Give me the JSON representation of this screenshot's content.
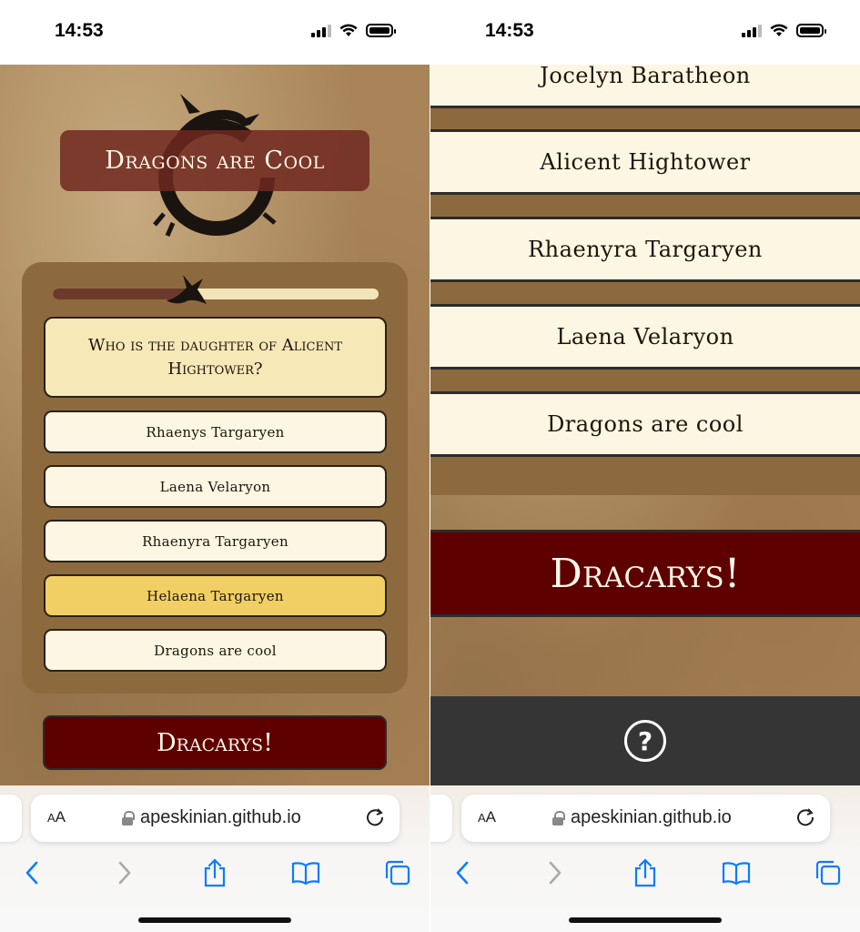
{
  "status_bar": {
    "time": "14:53"
  },
  "browser": {
    "aa_label_big": "A",
    "aa_label_small": "A",
    "url": "apeskinian.github.io"
  },
  "colors": {
    "parchment": "#a88458",
    "panel": "#8d6a3e",
    "title_box": "#702820",
    "answer_bg": "#fdf6e2",
    "selected_answer": "#f1cf64",
    "question_bg": "#f7e8b8",
    "submit_bg": "#5e0000",
    "footer_bg": "#353535",
    "ios_blue": "#0a7cff"
  },
  "left_screen": {
    "title": "Dragons are Cool",
    "progress": 0.45,
    "question": "Who is the daughter of Alicent Hightower?",
    "answers": [
      {
        "label": "Rhaenys Targaryen",
        "selected": false
      },
      {
        "label": "Laena Velaryon",
        "selected": false
      },
      {
        "label": "Rhaenyra Targaryen",
        "selected": false
      },
      {
        "label": "Helaena Targaryen",
        "selected": true
      },
      {
        "label": "Dragons are cool",
        "selected": false
      }
    ],
    "submit_label": "Dracarys!"
  },
  "right_screen": {
    "answers": [
      {
        "label": "Jocelyn Baratheon"
      },
      {
        "label": "Alicent Hightower"
      },
      {
        "label": "Rhaenyra Targaryen"
      },
      {
        "label": "Laena Velaryon"
      },
      {
        "label": "Dragons are cool"
      }
    ],
    "submit_label": "Dracarys!",
    "help_icon_symbol": "?"
  },
  "icons": {
    "back": "chevron-left-icon",
    "forward": "chevron-right-icon",
    "share": "share-icon",
    "bookmarks": "book-icon",
    "tabs": "tabs-icon",
    "reload": "reload-icon",
    "lock": "lock-icon",
    "help": "help-circle-icon",
    "logo": "dragon-ouroboros-icon"
  }
}
